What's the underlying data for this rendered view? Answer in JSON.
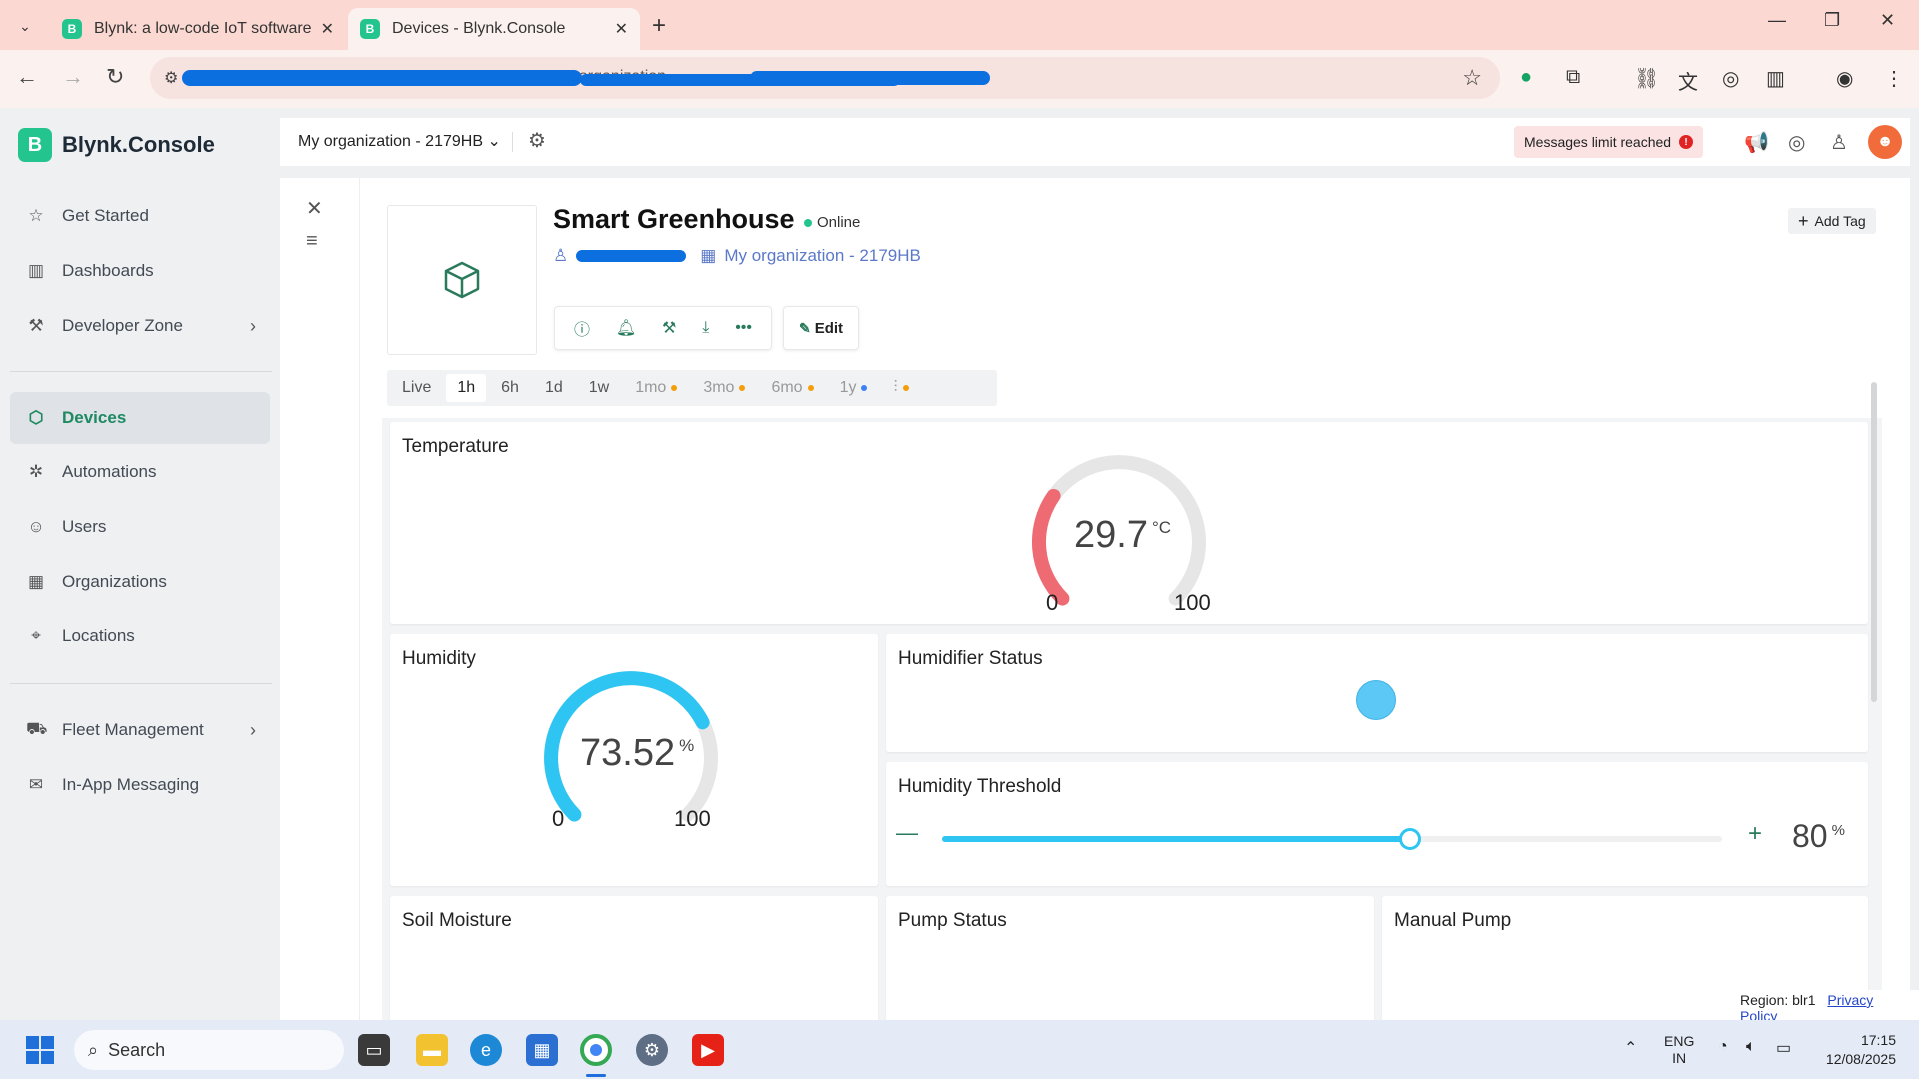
{
  "browser": {
    "tabs": [
      {
        "label": "Blynk: a low-code IoT software p",
        "favicon": "B",
        "active": false
      },
      {
        "label": "Devices - Blynk.Console",
        "favicon": "B",
        "active": true
      }
    ],
    "url_fragment": ", organization, ...",
    "window_controls": {
      "minimize": "—",
      "restore": "❐",
      "close": "✕"
    }
  },
  "app": {
    "brand": "Blynk.Console",
    "brand_mark": "B",
    "sidebar": {
      "items": [
        {
          "label": "Get Started",
          "icon": "star-icon"
        },
        {
          "label": "Dashboards",
          "icon": "bar-chart-icon"
        },
        {
          "label": "Developer Zone",
          "icon": "tools-icon",
          "has_submenu": true
        },
        {
          "label": "Devices",
          "icon": "cube-icon",
          "active": true
        },
        {
          "label": "Automations",
          "icon": "automation-icon"
        },
        {
          "label": "Users",
          "icon": "users-icon"
        },
        {
          "label": "Organizations",
          "icon": "building-icon"
        },
        {
          "label": "Locations",
          "icon": "pin-icon"
        },
        {
          "label": "Fleet Management",
          "icon": "truck-icon",
          "has_submenu": true
        },
        {
          "label": "In-App Messaging",
          "icon": "messaging-icon"
        }
      ]
    },
    "topbar": {
      "org_selector": "My organization - 2179HB",
      "messages_limit": "Messages limit reached",
      "messages_limit_icon": "!"
    },
    "device": {
      "name": "Smart Greenhouse",
      "status": "Online",
      "organization": "My organization - 2179HB",
      "edit_label": "Edit",
      "add_tag_label": "Add Tag"
    },
    "time_ranges": [
      {
        "label": "Live",
        "state": "normal"
      },
      {
        "label": "1h",
        "state": "selected"
      },
      {
        "label": "6h",
        "state": "normal"
      },
      {
        "label": "1d",
        "state": "normal"
      },
      {
        "label": "1w",
        "state": "normal"
      },
      {
        "label": "1mo",
        "state": "dim",
        "dot": "orange"
      },
      {
        "label": "3mo",
        "state": "dim",
        "dot": "orange"
      },
      {
        "label": "6mo",
        "state": "dim",
        "dot": "orange"
      },
      {
        "label": "1y",
        "state": "dim",
        "dot": "blue"
      }
    ],
    "widgets": {
      "temperature": {
        "title": "Temperature",
        "value": "29.7",
        "unit": "°C",
        "min": "0",
        "max": "100",
        "color": "#ef6b73",
        "fraction": 0.297
      },
      "humidity": {
        "title": "Humidity",
        "value": "73.52",
        "unit": "%",
        "min": "0",
        "max": "100",
        "color": "#2ec5f2",
        "fraction": 0.7352
      },
      "humidifier_status": {
        "title": "Humidifier Status",
        "led_color": "#5cc8f5"
      },
      "humidity_threshold": {
        "title": "Humidity Threshold",
        "value": "80",
        "unit": "%",
        "minus": "—",
        "plus": "+",
        "fraction": 0.6
      },
      "soil_moisture": {
        "title": "Soil Moisture"
      },
      "pump_status": {
        "title": "Pump Status"
      },
      "manual_pump": {
        "title": "Manual Pump"
      }
    },
    "footer": {
      "region": "Region: blr1",
      "privacy": "Privacy Policy"
    }
  },
  "taskbar": {
    "search_placeholder": "Search",
    "lang_line1": "ENG",
    "lang_line2": "IN",
    "time": "17:15",
    "date": "12/08/2025"
  }
}
